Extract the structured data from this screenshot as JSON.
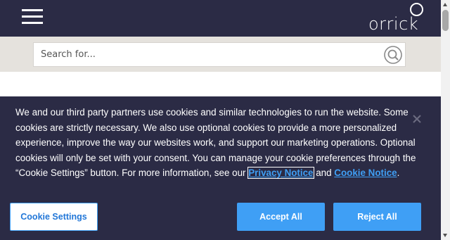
{
  "header": {
    "logo_text": "orrick",
    "menu_icon": "hamburger-menu-icon",
    "background": "#2b2b45"
  },
  "search": {
    "placeholder": "Search for...",
    "icon": "search-icon"
  },
  "cookie_banner": {
    "text_before": "We and our third party partners use cookies and similar technologies to run the website. Some cookies are strictly necessary. We also use optional cookies to provide a more personalized experience, improve the way our websites work, and support our marketing operations. Optional cookies will only be set with your consent. You can manage your cookie preferences through the “Cookie Settings” button. For more information, see our ",
    "privacy_link": "Privacy Notice",
    "and_text": " and ",
    "cookie_link": "Cookie Notice",
    "end_text": ".",
    "settings_label": "Cookie Settings",
    "accept_label": "Accept All",
    "reject_label": "Reject All",
    "close_icon": "close-icon",
    "link_color": "#3f9ff5",
    "background": "#2b2b45"
  }
}
